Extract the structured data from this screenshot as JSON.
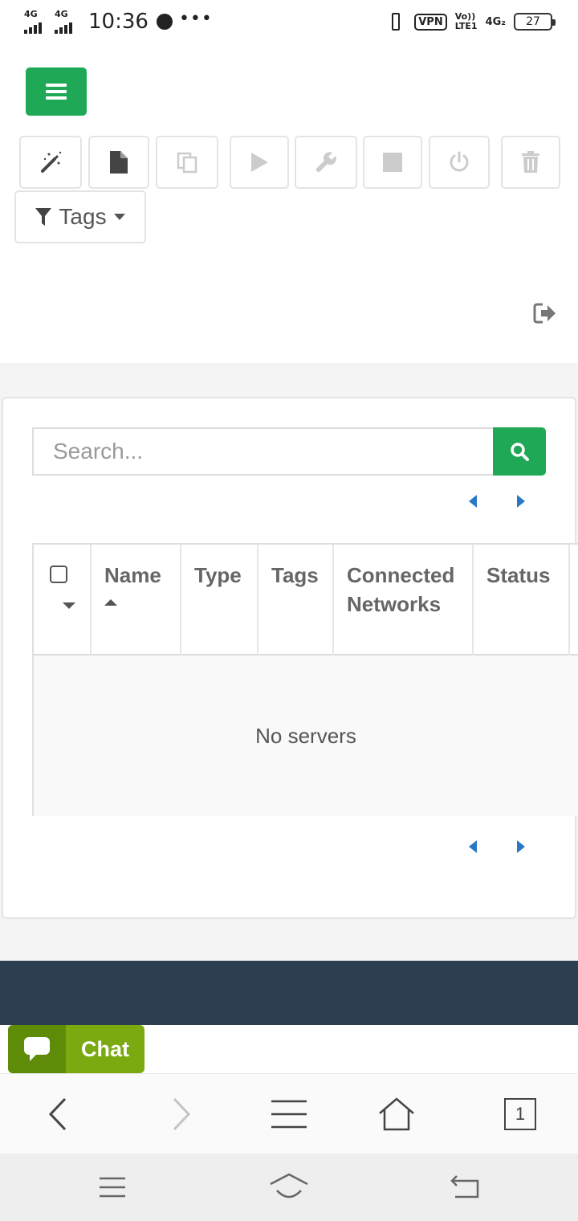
{
  "status_bar": {
    "sim1": "4G",
    "sim2": "4G",
    "time": "10:36",
    "dots": "•••",
    "vpn": "VPN",
    "volte_top": "Vo))",
    "volte_bottom": "LTE1",
    "network": "4G₂",
    "battery": "27"
  },
  "toolbar": {
    "menu_icon": "hamburger-icon",
    "buttons": [
      {
        "icon": "magic-wand-icon",
        "enabled": true
      },
      {
        "icon": "file-icon",
        "enabled": true
      },
      {
        "icon": "copy-icon",
        "enabled": false
      },
      {
        "icon": "play-icon",
        "enabled": false
      },
      {
        "icon": "wrench-icon",
        "enabled": false
      },
      {
        "icon": "stop-icon",
        "enabled": false
      },
      {
        "icon": "power-icon",
        "enabled": false
      },
      {
        "icon": "trash-icon",
        "enabled": false
      }
    ],
    "tags_label": "Tags"
  },
  "search": {
    "placeholder": "Search...",
    "value": ""
  },
  "table": {
    "columns": [
      "Name",
      "Type",
      "Tags",
      "Connected Networks",
      "Status"
    ],
    "sorted_column": "Name",
    "empty_message": "No servers"
  },
  "chat": {
    "label": "Chat"
  },
  "browser": {
    "tab_count": "1"
  },
  "colors": {
    "primary_green": "#1fa855",
    "chat_green": "#7aaa0f",
    "footer_dark": "#2d3e50",
    "pager_blue": "#2a78c5"
  }
}
